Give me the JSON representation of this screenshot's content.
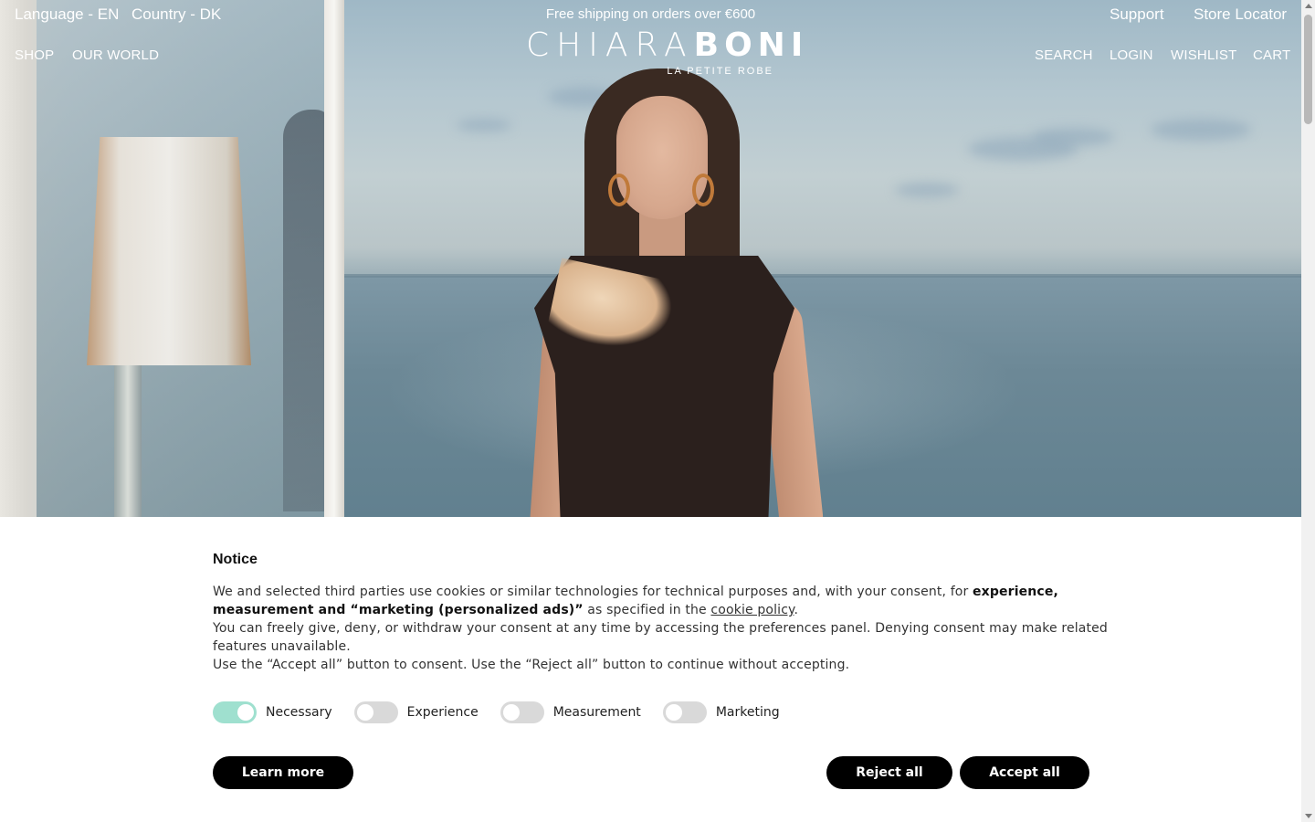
{
  "topbar": {
    "language": "Language - EN",
    "country": "Country - DK",
    "promo": "Free shipping on orders over €600",
    "support": "Support",
    "store_locator": "Store Locator"
  },
  "nav": {
    "left": [
      "SHOP",
      "OUR WORLD"
    ],
    "right": [
      "SEARCH",
      "LOGIN",
      "WISHLIST",
      "CART"
    ]
  },
  "logo": {
    "part1": "CHIARA",
    "part2": "BONI",
    "tagline": "LA PETITE ROBE"
  },
  "cookie": {
    "title": "Notice",
    "text_1": "We and selected third parties use cookies or similar technologies for technical purposes and, with your consent, for ",
    "text_bold": "experience, measurement and “marketing (personalized ads)”",
    "text_2": " as specified in the ",
    "link": "cookie policy",
    "text_3": ".",
    "line_2": "You can freely give, deny, or withdraw your consent at any time by accessing the preferences panel. Denying consent may make related features unavailable.",
    "line_3": "Use the “Accept all” button to consent. Use the “Reject all” button to continue without accepting.",
    "toggles": [
      {
        "label": "Necessary",
        "on": true
      },
      {
        "label": "Experience",
        "on": false
      },
      {
        "label": "Measurement",
        "on": false
      },
      {
        "label": "Marketing",
        "on": false
      }
    ],
    "learn_more": "Learn more",
    "reject_all": "Reject all",
    "accept_all": "Accept all"
  },
  "colors": {
    "toggle_on": "#9fe0cf",
    "toggle_off": "#d9d9d9",
    "button_bg": "#000000"
  }
}
